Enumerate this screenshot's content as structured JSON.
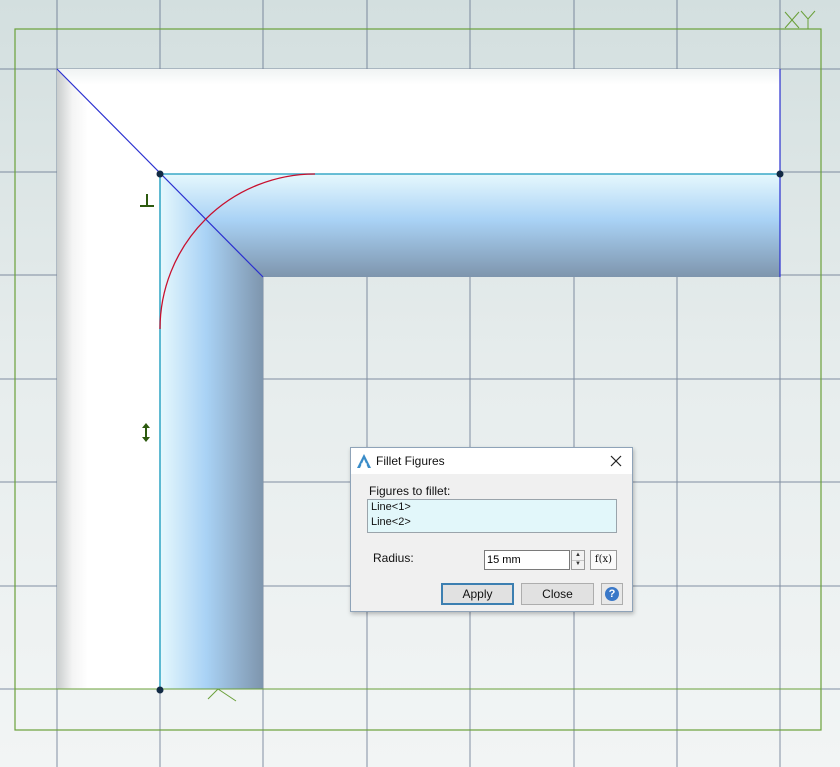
{
  "canvas": {
    "background_color": "#dfe8e8",
    "grid_color": "#5d6d88",
    "frame_color": "#6aa03a",
    "axis_label": "XY",
    "constraint_icons": [
      "perpendicular-icon",
      "vertical-icon"
    ]
  },
  "dialog": {
    "title": "Fillet Figures",
    "figures_label": "Figures to fillet:",
    "figures": [
      "Line<1>",
      "Line<2>"
    ],
    "radius_label": "Radius:",
    "radius_value": "15 mm",
    "fx_label": "f(x)",
    "apply_label": "Apply",
    "close_label": "Close",
    "help_label": "?"
  }
}
